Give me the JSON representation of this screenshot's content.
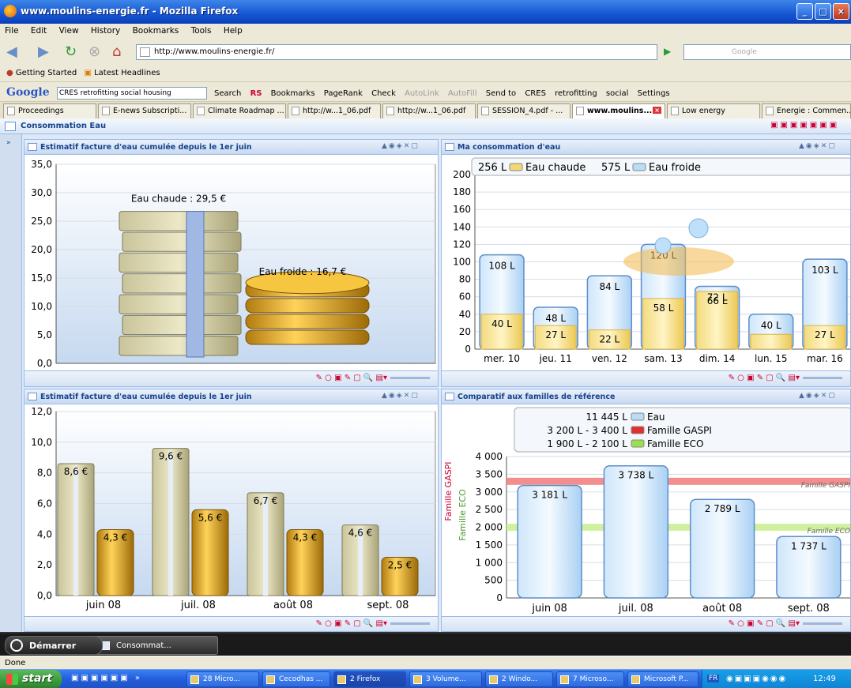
{
  "window": {
    "title": "www.moulins-energie.fr - Mozilla Firefox"
  },
  "menu": [
    "File",
    "Edit",
    "View",
    "History",
    "Bookmarks",
    "Tools",
    "Help"
  ],
  "nav": {
    "url": "http://www.moulins-energie.fr/",
    "search_placeholder": "Google"
  },
  "bookmarks": [
    "Getting Started",
    "Latest Headlines"
  ],
  "google_toolbar": {
    "query": "CRES retrofitting social housing",
    "items": [
      "Search",
      "RS",
      "Bookmarks",
      "PageRank",
      "Check",
      "AutoLink",
      "AutoFill",
      "Send to",
      "CRES",
      "retrofitting",
      "social",
      "Settings"
    ]
  },
  "tabs": [
    "Proceedings",
    "E-news Subscripti...",
    "Climate Roadmap ...",
    "http://w...1_06.pdf",
    "http://w...1_06.pdf",
    "SESSION_4.pdf - ...",
    "www.moulins...",
    "Low energy",
    "Energie : Commen..."
  ],
  "app": {
    "title": "Consommation Eau"
  },
  "panel1": {
    "title": "Estimatif facture d'eau cumulée depuis le 1er juin",
    "chart_data": {
      "type": "bar",
      "ylim": [
        0,
        35
      ],
      "yticks": [
        "0,0",
        "5,0",
        "10,0",
        "15,0",
        "20,0",
        "25,0",
        "30,0",
        "35,0"
      ],
      "categories": [
        "Eau chaude",
        "Eau froide"
      ],
      "values": [
        29.5,
        16.7
      ],
      "labels": [
        "Eau chaude : 29,5 €",
        "Eau froide : 16,7 €"
      ]
    }
  },
  "panel2": {
    "title": "Ma consommation d'eau",
    "chart_data": {
      "type": "bar",
      "ylim": [
        0,
        200
      ],
      "yticks": [
        "0",
        "20",
        "40",
        "60",
        "80",
        "100",
        "120",
        "140",
        "160",
        "180",
        "200"
      ],
      "legend": [
        {
          "value": "256 L",
          "name": "Eau chaude",
          "color": "#f2d774"
        },
        {
          "value": "575 L",
          "name": "Eau froide",
          "color": "#b9dcf7"
        }
      ],
      "categories": [
        "mer. 10",
        "jeu. 11",
        "ven. 12",
        "sam. 13",
        "dim. 14",
        "lun. 15",
        "mar. 16"
      ],
      "series": [
        {
          "name": "Eau froide",
          "values": [
            108,
            48,
            84,
            120,
            72,
            40,
            103
          ],
          "labels": [
            "108 L",
            "48 L",
            "84 L",
            "120 L",
            "72 L",
            "40 L",
            "103 L"
          ]
        },
        {
          "name": "Eau chaude",
          "values": [
            40,
            27,
            22,
            58,
            66,
            17,
            27
          ],
          "labels": [
            "40 L",
            "27 L",
            "22 L",
            "58 L",
            "66 L",
            "",
            "27 L"
          ]
        }
      ]
    }
  },
  "panel3": {
    "title": "Estimatif facture d'eau cumulée depuis le 1er juin",
    "chart_data": {
      "type": "bar",
      "ylim": [
        0,
        12
      ],
      "yticks": [
        "0,0",
        "2,0",
        "4,0",
        "6,0",
        "8,0",
        "10,0",
        "12,0"
      ],
      "categories": [
        "juin 08",
        "juil. 08",
        "août 08",
        "sept. 08"
      ],
      "series": [
        {
          "name": "Eau chaude",
          "values": [
            8.6,
            9.6,
            6.7,
            4.6
          ],
          "labels": [
            "8,6 €",
            "9,6 €",
            "6,7 €",
            "4,6 €"
          ]
        },
        {
          "name": "Eau froide",
          "values": [
            4.3,
            5.6,
            4.3,
            2.5
          ],
          "labels": [
            "4,3 €",
            "5,6 €",
            "4,3 €",
            "2,5 €"
          ]
        }
      ]
    }
  },
  "panel4": {
    "title": "Comparatif aux familles de référence",
    "chart_data": {
      "type": "bar",
      "ylim": [
        0,
        4000
      ],
      "yticks": [
        "0",
        "500",
        "1 000",
        "1 500",
        "2 000",
        "2 500",
        "3 000",
        "3 500",
        "4 000"
      ],
      "legend": [
        {
          "value": "11 445 L",
          "name": "Eau",
          "color": "#b9dcf7"
        },
        {
          "value": "3 200 L - 3 400 L",
          "name": "Famille GASPI",
          "color": "#e03030"
        },
        {
          "value": "1 900 L - 2 100 L",
          "name": "Famille ECO",
          "color": "#9be04c"
        }
      ],
      "categories": [
        "juin 08",
        "juil. 08",
        "août 08",
        "sept. 08"
      ],
      "values": [
        3181,
        3738,
        2789,
        1737
      ],
      "labels": [
        "3 181 L",
        "3 738 L",
        "2 789 L",
        "1 737 L"
      ],
      "bands": [
        {
          "name": "Famille GASPI",
          "range": [
            3200,
            3400
          ],
          "label": "Famille GASPI"
        },
        {
          "name": "Famille ECO",
          "range": [
            1900,
            2100
          ],
          "label": "Famille ECO"
        }
      ],
      "side_labels": [
        "Famille GASPI",
        "Famille ECO"
      ]
    }
  },
  "taskbar_app": {
    "start": "Démarrer",
    "item": "Consommat..."
  },
  "status": "Done",
  "wintaskbar": {
    "start": "start",
    "items": [
      "28 Micro...",
      "Cecodhas ...",
      "2 Firefox",
      "3 Volume...",
      "2 Windo...",
      "7 Microso...",
      "Microsoft P..."
    ],
    "lang": "FR",
    "time": "12:49"
  }
}
